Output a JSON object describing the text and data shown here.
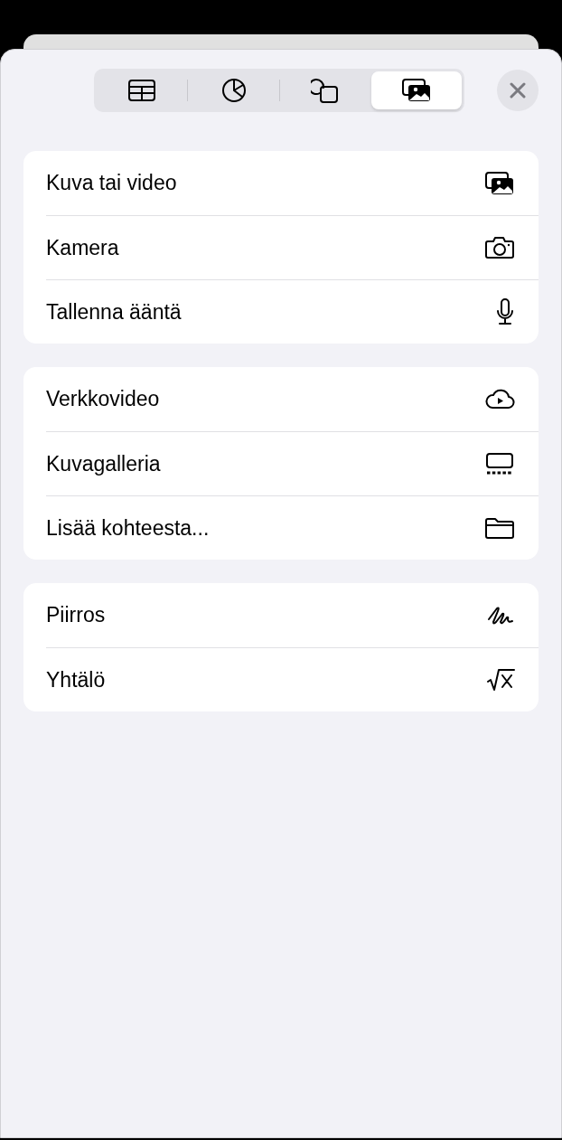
{
  "tabs": [
    {
      "kind": "table",
      "selected": false
    },
    {
      "kind": "chart",
      "selected": false
    },
    {
      "kind": "shape",
      "selected": false
    },
    {
      "kind": "media",
      "selected": true
    }
  ],
  "groups": [
    {
      "items": [
        {
          "label": "Kuva tai video",
          "kind": "photos"
        },
        {
          "label": "Kamera",
          "kind": "camera"
        },
        {
          "label": "Tallenna ääntä",
          "kind": "mic"
        }
      ]
    },
    {
      "items": [
        {
          "label": "Verkkovideo",
          "kind": "cloud"
        },
        {
          "label": "Kuvagalleria",
          "kind": "gallery"
        },
        {
          "label": "Lisää kohteesta...",
          "kind": "folder"
        }
      ]
    },
    {
      "items": [
        {
          "label": "Piirros",
          "kind": "drawing"
        },
        {
          "label": "Yhtälö",
          "kind": "equation"
        }
      ]
    }
  ]
}
